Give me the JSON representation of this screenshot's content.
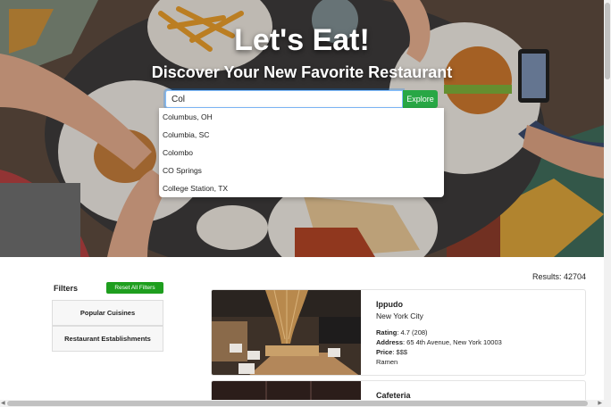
{
  "hero": {
    "title": "Let's Eat!",
    "subtitle": "Discover Your New Favorite Restaurant"
  },
  "search": {
    "value": "Col",
    "button_label": "Explore",
    "suggestions": [
      "Columbus, OH",
      "Columbia, SC",
      "Colombo",
      "CO Springs",
      "College Station, TX"
    ]
  },
  "results": {
    "label": "Results: 42704"
  },
  "filters": {
    "title": "Filters",
    "reset_label": "Reset All Filters",
    "groups": [
      "Popular Cuisines",
      "Restaurant Establishments"
    ]
  },
  "restaurants": [
    {
      "name": "Ippudo",
      "city": "New York City",
      "rating_label": "Rating",
      "rating": ": 4.7 (208)",
      "address_label": "Address",
      "address": ": 65 4th Avenue, New York 10003",
      "price_label": "Price",
      "price": ": $$$",
      "cuisine": "Ramen"
    },
    {
      "name": "Cafeteria"
    }
  ],
  "colors": {
    "accent_green": "#28a745",
    "reset_green": "#1e9e1e",
    "focus_blue": "#80bdff"
  }
}
